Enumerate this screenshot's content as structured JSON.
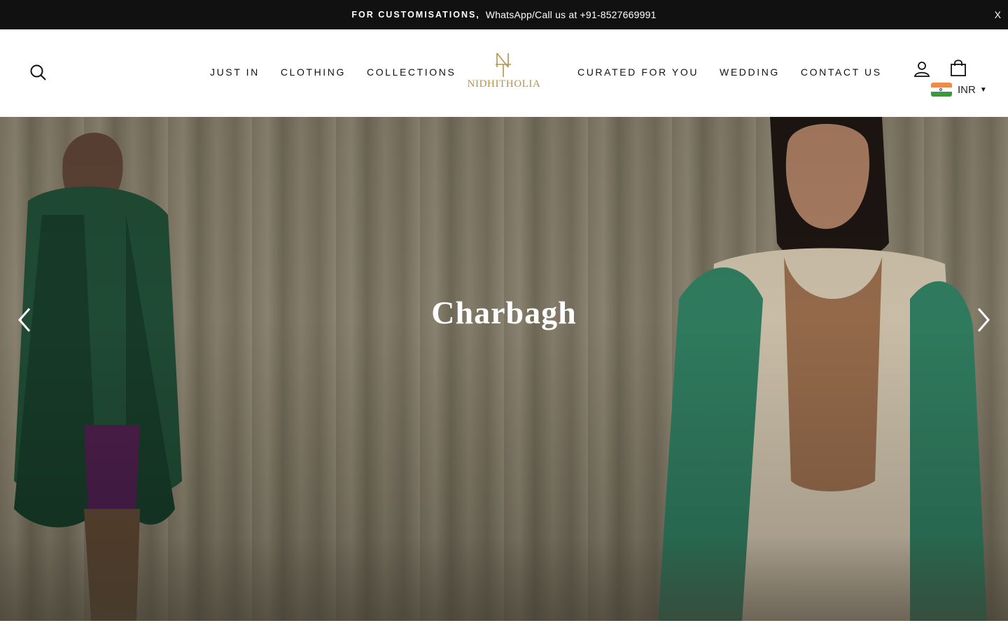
{
  "announcement": {
    "bold": "FOR CUSTOMISATIONS,",
    "text": "WhatsApp/Call us at +91-8527669991",
    "close": "X"
  },
  "header": {
    "nav_left": [
      "JUST IN",
      "CLOTHING",
      "COLLECTIONS"
    ],
    "nav_right": [
      "CURATED FOR YOU",
      "WEDDING",
      "CONTACT US"
    ],
    "logo_text": "NIDHITHOLIA",
    "currency": {
      "code": "INR",
      "flag": "india-flag-icon"
    }
  },
  "hero": {
    "title": "Charbagh"
  },
  "colors": {
    "announcement_bg": "#111111",
    "logo_gold": "#b8924a",
    "hero_title": "#ffffff"
  },
  "icons": [
    "search-icon",
    "user-icon",
    "shopping-bag-icon",
    "chevron-down-icon",
    "chevron-left-icon",
    "chevron-right-icon"
  ]
}
